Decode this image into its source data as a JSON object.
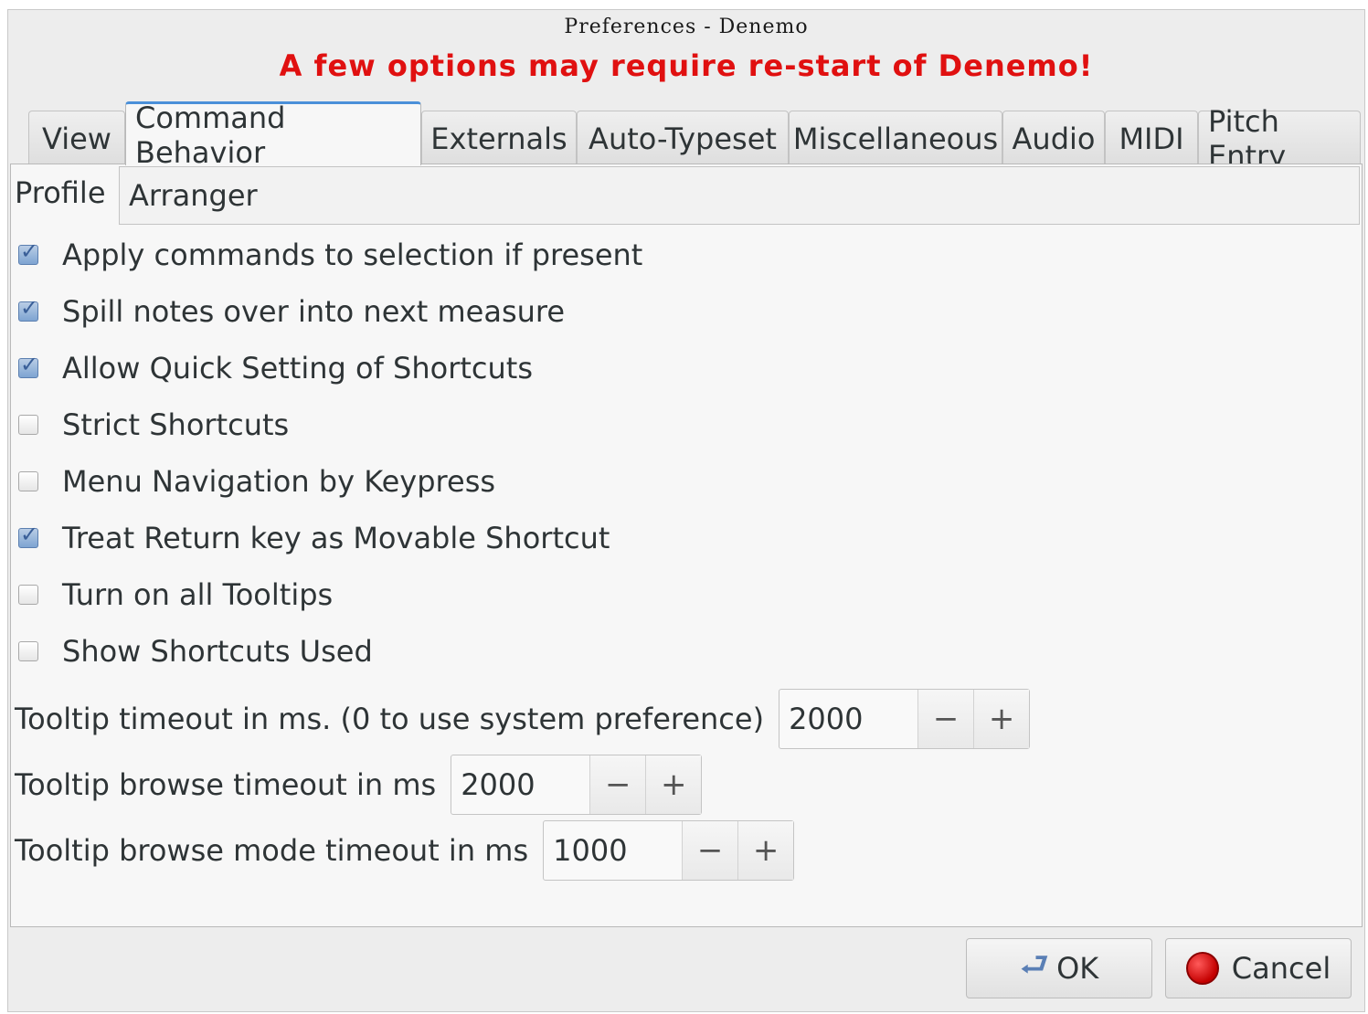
{
  "window": {
    "title": "Preferences - Denemo",
    "warning": "A few options may require re-start of Denemo!"
  },
  "tabs": [
    {
      "label": "View"
    },
    {
      "label": "Command Behavior",
      "active": true
    },
    {
      "label": "Externals"
    },
    {
      "label": "Auto-Typeset"
    },
    {
      "label": "Miscellaneous"
    },
    {
      "label": "Audio"
    },
    {
      "label": "MIDI"
    },
    {
      "label": "Pitch Entry"
    }
  ],
  "profile": {
    "label": "Profile",
    "value": "Arranger"
  },
  "checks": [
    {
      "label": "Apply commands to selection if present",
      "checked": true
    },
    {
      "label": "Spill notes over into next measure",
      "checked": true
    },
    {
      "label": "Allow Quick Setting of Shortcuts",
      "checked": true
    },
    {
      "label": "Strict Shortcuts",
      "checked": false
    },
    {
      "label": "Menu Navigation by Keypress",
      "checked": false
    },
    {
      "label": "Treat Return key as Movable Shortcut",
      "checked": true
    },
    {
      "label": "Turn on all Tooltips",
      "checked": false
    },
    {
      "label": "Show Shortcuts Used",
      "checked": false
    }
  ],
  "spinners": [
    {
      "label": "Tooltip timeout in ms. (0 to use system preference)",
      "value": "2000",
      "minus": "−",
      "plus": "+"
    },
    {
      "label": "Tooltip browse timeout in ms",
      "value": "2000",
      "minus": "−",
      "plus": "+"
    },
    {
      "label": "Tooltip browse mode timeout in ms",
      "value": "1000",
      "minus": "−",
      "plus": "+"
    }
  ],
  "buttons": {
    "ok": "OK",
    "cancel": "Cancel"
  },
  "colors": {
    "warning": "#e01010",
    "accent": "#4a90d9"
  }
}
